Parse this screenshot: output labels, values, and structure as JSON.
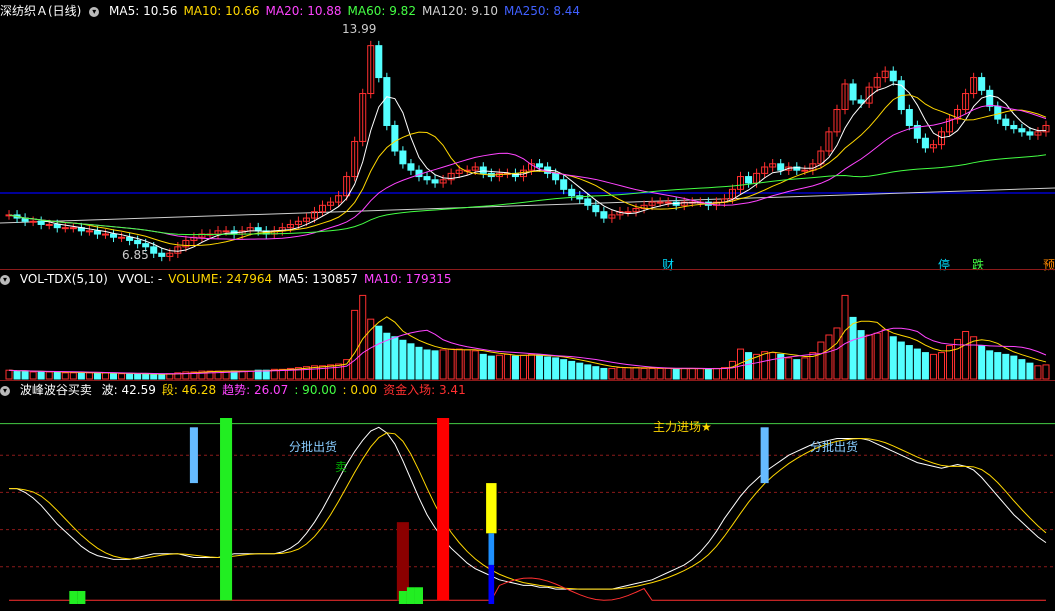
{
  "header1": {
    "title": "深纺织Ａ(日线)",
    "ma": [
      {
        "label": "MA5: 10.56",
        "color": "#ffffff"
      },
      {
        "label": "MA10: 10.66",
        "color": "#ffd700"
      },
      {
        "label": "MA20: 10.88",
        "color": "#ff44ff"
      },
      {
        "label": "MA60: 9.82",
        "color": "#44ff44"
      },
      {
        "label": "MA120: 9.10",
        "color": "#d0d0d0"
      },
      {
        "label": "MA250: 8.44",
        "color": "#4060ff"
      }
    ]
  },
  "header2": {
    "title": "VOL-TDX(5,10)",
    "items": [
      {
        "label": "VVOL: -",
        "color": "#ffffff"
      },
      {
        "label": "VOLUME: 247964",
        "color": "#ffd700"
      },
      {
        "label": "MA5: 130857",
        "color": "#ffffff"
      },
      {
        "label": "MA10: 179315",
        "color": "#ff44ff"
      }
    ]
  },
  "header3": {
    "title": "波峰波谷买卖",
    "items": [
      {
        "label": "波: 42.59",
        "color": "#ffffff"
      },
      {
        "label": "段: 46.28",
        "color": "#ffd700"
      },
      {
        "label": "趋势: 26.07",
        "color": "#ff44ff"
      },
      {
        "label": ": 90.00",
        "color": "#44ff44"
      },
      {
        "label": ": 0.00",
        "color": "#ffd700"
      },
      {
        "label": "资金入场: 3.41",
        "color": "#ff3030"
      }
    ]
  },
  "labels": {
    "high": "13.99",
    "low": "6.85",
    "cai": "财",
    "ting": "停",
    "die": "跌",
    "yu": "预",
    "fenpi1": "分批出货",
    "fenpi2": "分批出货",
    "mai": "卖",
    "zhuli": "主力进场★"
  },
  "chart_data": {
    "type": "candlestick",
    "price_min": 6.85,
    "price_max": 13.99,
    "close": [
      8.2,
      8.1,
      8.0,
      8.0,
      7.9,
      7.9,
      7.8,
      7.8,
      7.8,
      7.7,
      7.7,
      7.6,
      7.6,
      7.5,
      7.5,
      7.4,
      7.3,
      7.2,
      7.0,
      6.9,
      7.0,
      7.2,
      7.4,
      7.5,
      7.6,
      7.6,
      7.7,
      7.7,
      7.6,
      7.7,
      7.8,
      7.7,
      7.6,
      7.7,
      7.8,
      7.9,
      8.0,
      8.1,
      8.3,
      8.5,
      8.6,
      8.8,
      9.4,
      10.5,
      12.0,
      13.5,
      12.5,
      11.0,
      10.2,
      9.8,
      9.6,
      9.4,
      9.3,
      9.2,
      9.3,
      9.5,
      9.6,
      9.6,
      9.7,
      9.5,
      9.4,
      9.5,
      9.5,
      9.4,
      9.6,
      9.8,
      9.7,
      9.5,
      9.3,
      9.0,
      8.8,
      8.7,
      8.5,
      8.3,
      8.1,
      8.2,
      8.3,
      8.3,
      8.4,
      8.5,
      8.6,
      8.6,
      8.6,
      8.5,
      8.6,
      8.6,
      8.6,
      8.5,
      8.6,
      8.7,
      9.0,
      9.4,
      9.2,
      9.5,
      9.7,
      9.8,
      9.6,
      9.7,
      9.6,
      9.6,
      9.8,
      10.2,
      10.8,
      11.5,
      12.3,
      11.8,
      11.7,
      12.2,
      12.5,
      12.7,
      12.4,
      11.5,
      11.0,
      10.6,
      10.3,
      10.4,
      10.8,
      11.2,
      11.5,
      12.0,
      12.5,
      12.1,
      11.6,
      11.2,
      11.0,
      10.9,
      10.8,
      10.7,
      10.8,
      11.0
    ],
    "volume": [
      10,
      9,
      9,
      8,
      8,
      8,
      8,
      7,
      7,
      7,
      7,
      7,
      7,
      6,
      6,
      6,
      6,
      6,
      5,
      5,
      6,
      7,
      8,
      8,
      9,
      9,
      9,
      9,
      9,
      9,
      9,
      10,
      10,
      11,
      11,
      12,
      13,
      14,
      15,
      15,
      16,
      17,
      22,
      78,
      95,
      68,
      60,
      52,
      48,
      44,
      40,
      36,
      33,
      32,
      33,
      34,
      34,
      33,
      32,
      28,
      26,
      27,
      28,
      26,
      27,
      28,
      27,
      25,
      24,
      22,
      20,
      18,
      16,
      14,
      12,
      12,
      13,
      13,
      13,
      12,
      12,
      12,
      12,
      11,
      12,
      12,
      12,
      11,
      12,
      13,
      20,
      34,
      30,
      28,
      31,
      30,
      28,
      24,
      22,
      24,
      30,
      42,
      50,
      58,
      95,
      70,
      55,
      50,
      52,
      56,
      48,
      42,
      38,
      34,
      30,
      28,
      30,
      38,
      45,
      54,
      48,
      38,
      32,
      30,
      28,
      26,
      22,
      18,
      15,
      16
    ],
    "volume_max": 100,
    "osc_min": 0,
    "osc_max": 100,
    "osc_wave": [
      62,
      62,
      60,
      57,
      53,
      48,
      43,
      39,
      35,
      31,
      28,
      26,
      25,
      24,
      24,
      24,
      25,
      26,
      27,
      27,
      27,
      27,
      26,
      25,
      25,
      25,
      25,
      26,
      27,
      27,
      27,
      27,
      27,
      27,
      28,
      30,
      33,
      38,
      44,
      51,
      59,
      67,
      75,
      82,
      88,
      93,
      95,
      92,
      86,
      77,
      67,
      57,
      48,
      41,
      35,
      30,
      26,
      22,
      19,
      17,
      15,
      13,
      12,
      11,
      10,
      10,
      9,
      9,
      8,
      8,
      8,
      8,
      8,
      8,
      8,
      8,
      9,
      10,
      11,
      12,
      13,
      15,
      17,
      19,
      21,
      24,
      28,
      33,
      39,
      46,
      52,
      58,
      63,
      67,
      71,
      74,
      77,
      80,
      82,
      84,
      86,
      87,
      88,
      89,
      89,
      89,
      89,
      88,
      86,
      84,
      82,
      80,
      78,
      76,
      75,
      74,
      73,
      74,
      75,
      74,
      72,
      68,
      63,
      58,
      53,
      48,
      44,
      40,
      36,
      33
    ]
  }
}
